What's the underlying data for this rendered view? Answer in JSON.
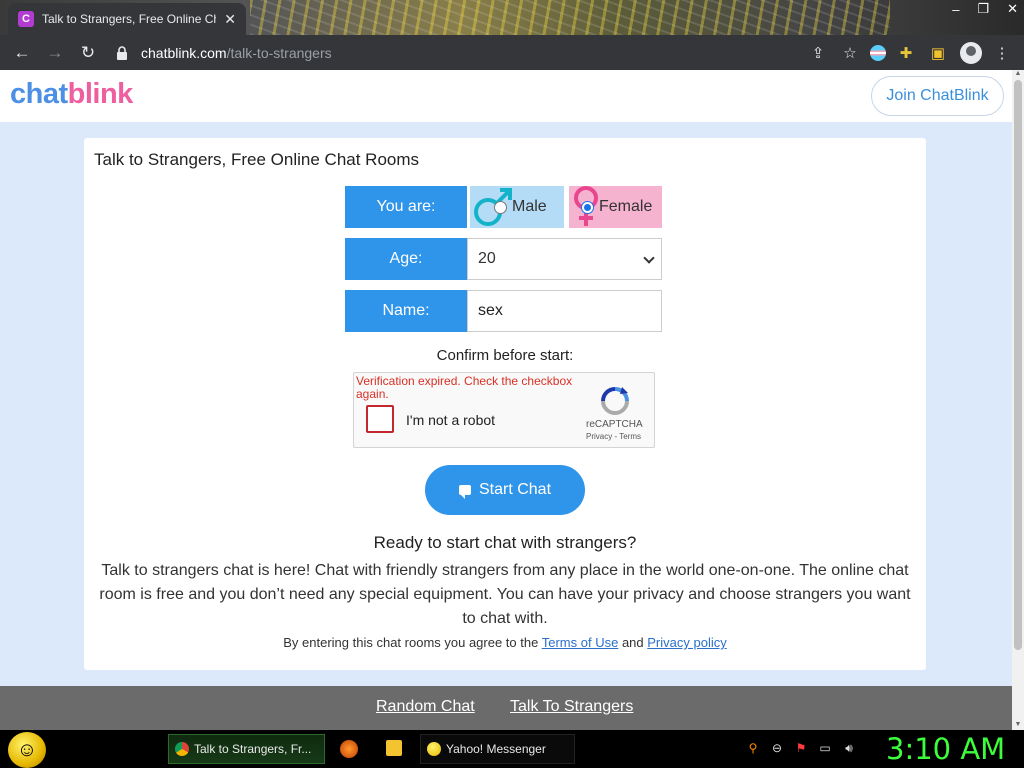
{
  "browser": {
    "tab_title": "Talk to Strangers, Free Online Ch",
    "tab_favicon": "C",
    "url_host": "chatblink.com",
    "url_path": "/talk-to-strangers"
  },
  "site": {
    "logo_part1": "chat",
    "logo_part2": "blink",
    "join_label": "Join ChatBlink",
    "colors": {
      "accent": "#2f95ea",
      "logo_blue": "#4e8fe6",
      "logo_pink": "#ee5fa0",
      "background": "#dbe9fb"
    }
  },
  "form": {
    "title": "Talk to Strangers, Free Online Chat Rooms",
    "gender_label": "You are:",
    "male_label": "Male",
    "female_label": "Female",
    "selected_gender": "Female",
    "age_label": "Age:",
    "age_value": "20",
    "name_label": "Name:",
    "name_value": "sex",
    "confirm_label": "Confirm before start:",
    "start_label": "Start Chat"
  },
  "recaptcha": {
    "error": "Verification expired. Check the checkbox again.",
    "checkbox_label": "I'm not a robot",
    "brand": "reCAPTCHA",
    "privacy": "Privacy",
    "terms": "Terms"
  },
  "content": {
    "heading": "Ready to start chat with strangers?",
    "paragraph": "Talk to strangers chat is here! Chat with friendly strangers from any place in the world one-on-one. The online chat room is free and you don’t need any special equipment. You can have your privacy and choose strangers you want to chat with.",
    "agree_prefix": "By entering this chat rooms you agree to the",
    "terms_link": "Terms of Use",
    "and": "and",
    "privacy_link": "Privacy policy"
  },
  "footer": {
    "link1": "Random Chat",
    "link2": "Talk To Strangers"
  },
  "taskbar": {
    "chrome_task": "Talk to Strangers, Fr...",
    "yahoo_task": "Yahoo! Messenger",
    "clock": "3:10 AM",
    "icons": [
      "start-orb-icon",
      "chrome-icon",
      "firefox-icon",
      "folder-icon",
      "yahoo-messenger-icon",
      "search-icon",
      "network-icon",
      "flag-icon",
      "monitor-icon",
      "volume-icon"
    ]
  }
}
